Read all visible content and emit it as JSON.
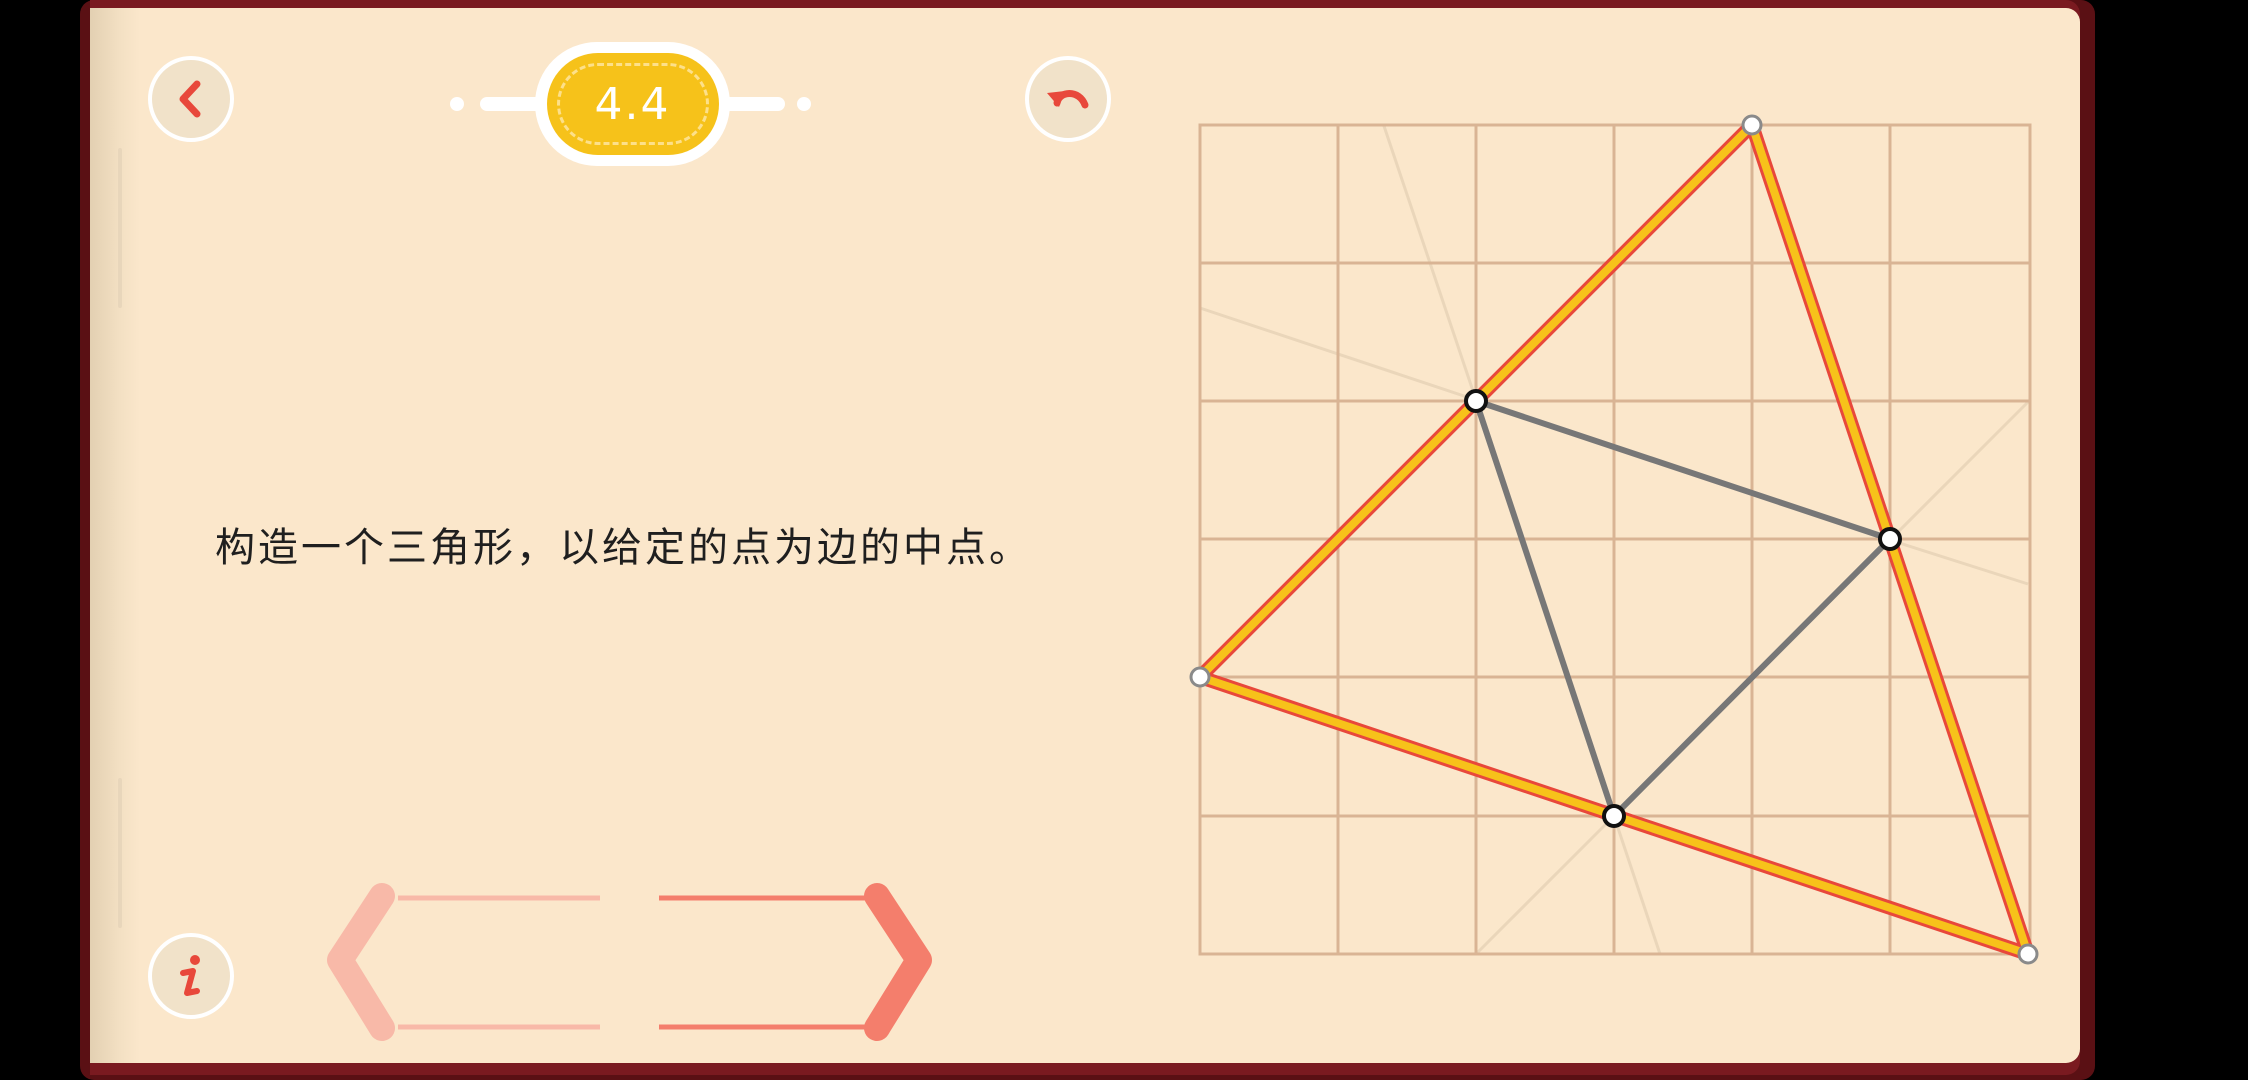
{
  "level": {
    "label": "4.4"
  },
  "instruction": "构造一个三角形，以给定的点为边的中点。",
  "icons": {
    "back": "chevron-left-icon",
    "undo": "undo-icon",
    "info": "info-icon",
    "prev": "prev-chevron-icon",
    "next": "next-chevron-icon"
  },
  "colors": {
    "page": "#fbe7cb",
    "grid": "#d9b494",
    "accent_red": "#e8483b",
    "triangle_fill_line": "#f7c21a",
    "triangle_edge": "#e8483b",
    "medial_line": "#7a7a7a",
    "nav_prev": "#f8b9a8",
    "nav_next": "#f47e6c"
  }
}
